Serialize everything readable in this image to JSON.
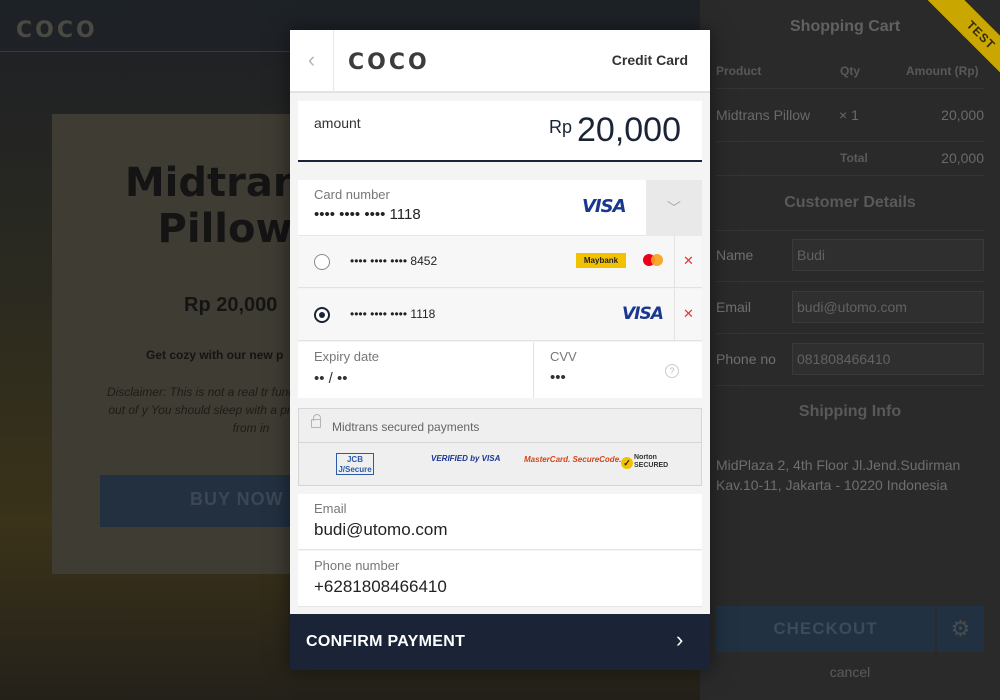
{
  "background": {
    "logo": "COCO",
    "product_title": "Midtrans Pillow",
    "price": "Rp 20,000",
    "description": "Get cozy with our new p",
    "disclaimer": "Disclaimer: This is not a real tr funds will be transfered out of y You should sleep with a prope refrain yourself from in",
    "buy_label": "BUY NOW"
  },
  "cart": {
    "title": "Shopping Cart",
    "count": "1",
    "test_badge": "TEST",
    "headers": {
      "product": "Product",
      "qty": "Qty",
      "amount": "Amount (Rp)"
    },
    "items": [
      {
        "product": "Midtrans Pillow",
        "qty": "× 1",
        "amount": "20,000"
      }
    ],
    "total_label": "Total",
    "total_value": "20,000",
    "customer_title": "Customer Details",
    "name_label": "Name",
    "name_value": "Budi",
    "email_label": "Email",
    "email_value": "budi@utomo.com",
    "phone_label": "Phone no",
    "phone_value": "081808466410",
    "shipping_title": "Shipping Info",
    "shipping_address": "MidPlaza 2, 4th Floor Jl.Jend.Sudirman Kav.10-11, Jakarta - 10220 Indonesia",
    "checkout_label": "CHECKOUT",
    "cancel_label": "cancel"
  },
  "modal": {
    "merchant_logo": "COCO",
    "payment_type": "Credit Card",
    "amount_label": "amount",
    "currency": "Rp",
    "amount_value": "20,000",
    "card_number_label": "Card number",
    "card_number_value": "•••• •••• •••• 1118",
    "card_brand": "VISA",
    "saved_cards": [
      {
        "number": "•••• •••• •••• 8452",
        "bank": "Maybank",
        "brand": "mastercard",
        "selected": false
      },
      {
        "number": "•••• •••• •••• 1118",
        "brand": "VISA",
        "selected": true
      }
    ],
    "expiry_label": "Expiry date",
    "expiry_value": "•• / ••",
    "cvv_label": "CVV",
    "cvv_value": "•••",
    "secured_text": "Midtrans secured payments",
    "security_logos": {
      "jcb": "JCB J/Secure",
      "vbv": "VERIFIED by VISA",
      "mastercard": "MasterCard. SecureCode.",
      "norton": "Norton SECURED"
    },
    "email_label": "Email",
    "email_value": "budi@utomo.com",
    "phone_label": "Phone number",
    "phone_value": "+6281808466410",
    "confirm_label": "CONFIRM PAYMENT"
  },
  "colors": {
    "primary_dark": "#1a2436",
    "maybank_yellow": "#f2c200",
    "visa_blue": "#1a3790",
    "delete_red": "#e03a3a",
    "test_ribbon": "#c9a700"
  }
}
